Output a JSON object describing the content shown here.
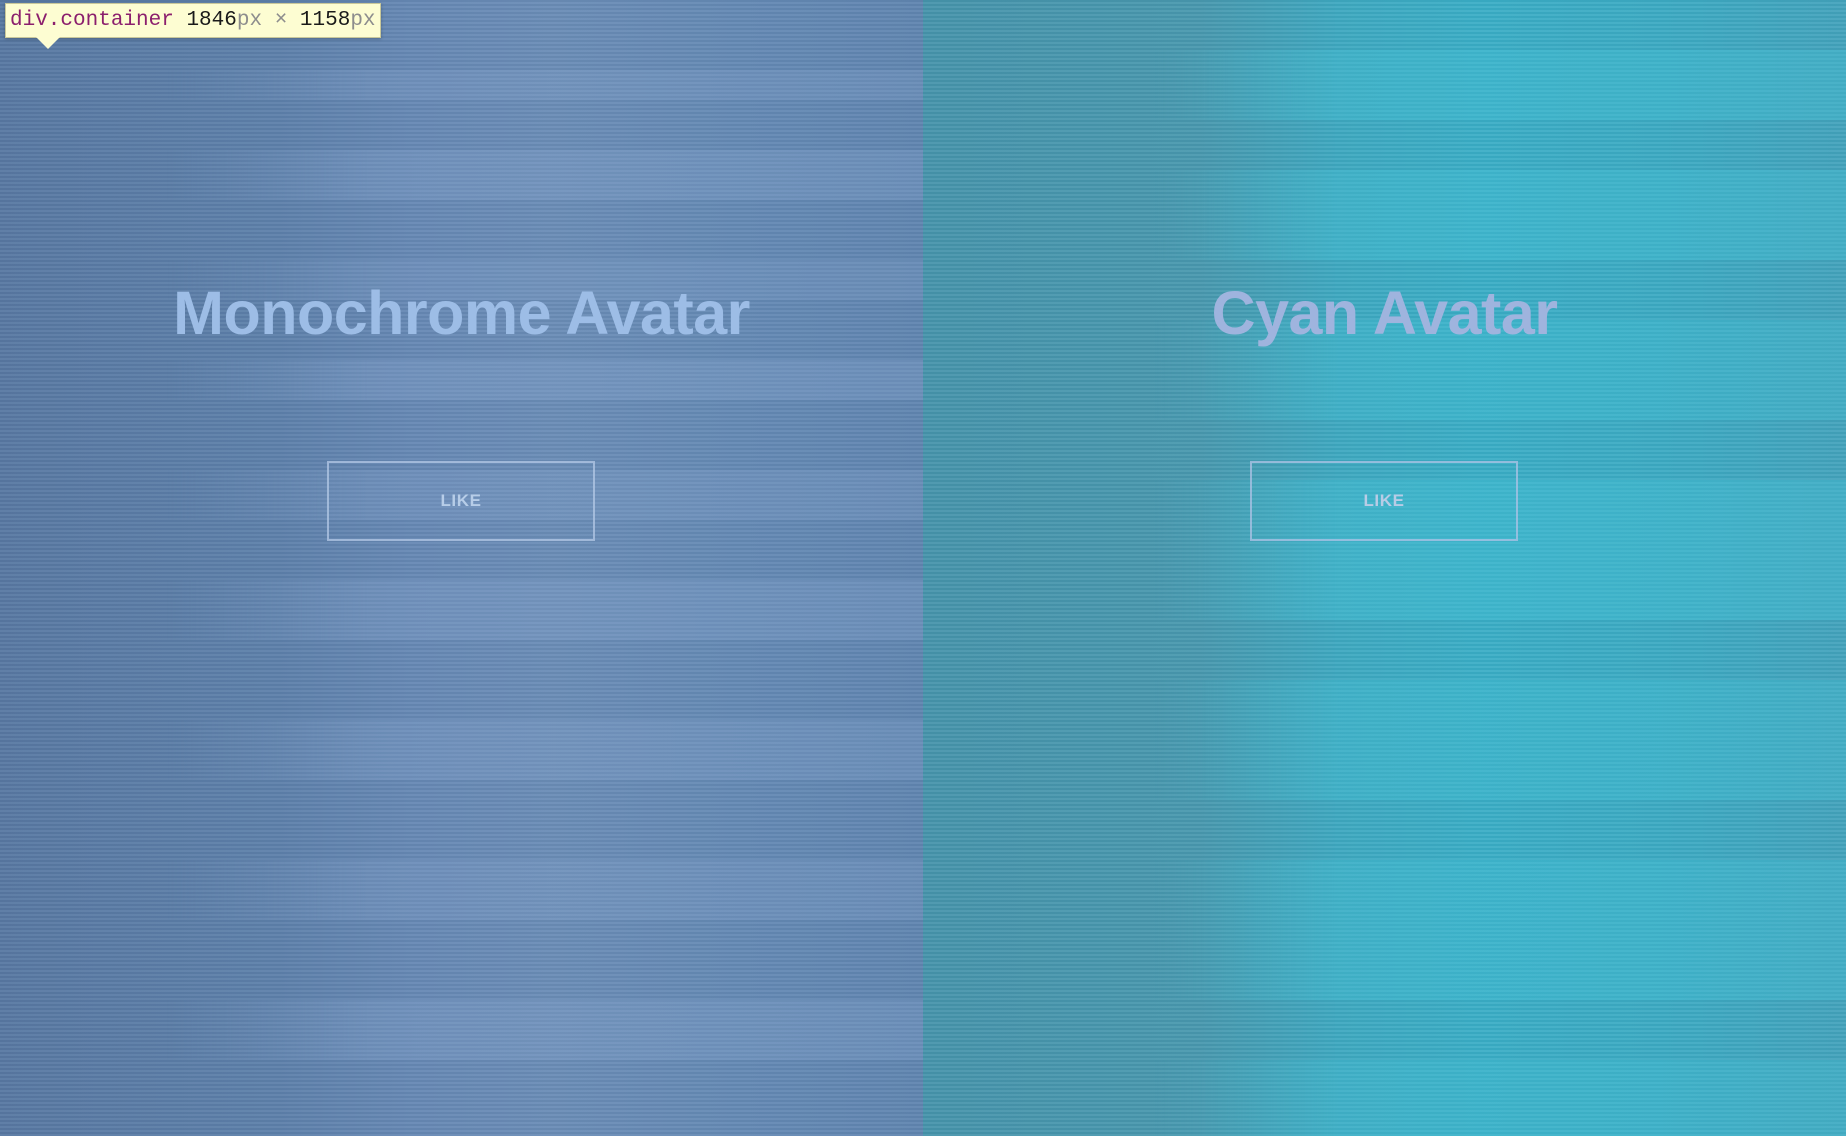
{
  "devtools_tooltip": {
    "selector": "div.container",
    "width": "1846",
    "height": "1158",
    "unit": "px",
    "times": "×"
  },
  "panels": [
    {
      "title": "Monochrome Avatar",
      "button_label": "LIKE",
      "background_color": "#5a7ea8",
      "title_color": "#9dbde6"
    },
    {
      "title": "Cyan Avatar",
      "button_label": "LIKE",
      "background_color": "#4796ad",
      "title_color": "#9fb4de"
    }
  ]
}
